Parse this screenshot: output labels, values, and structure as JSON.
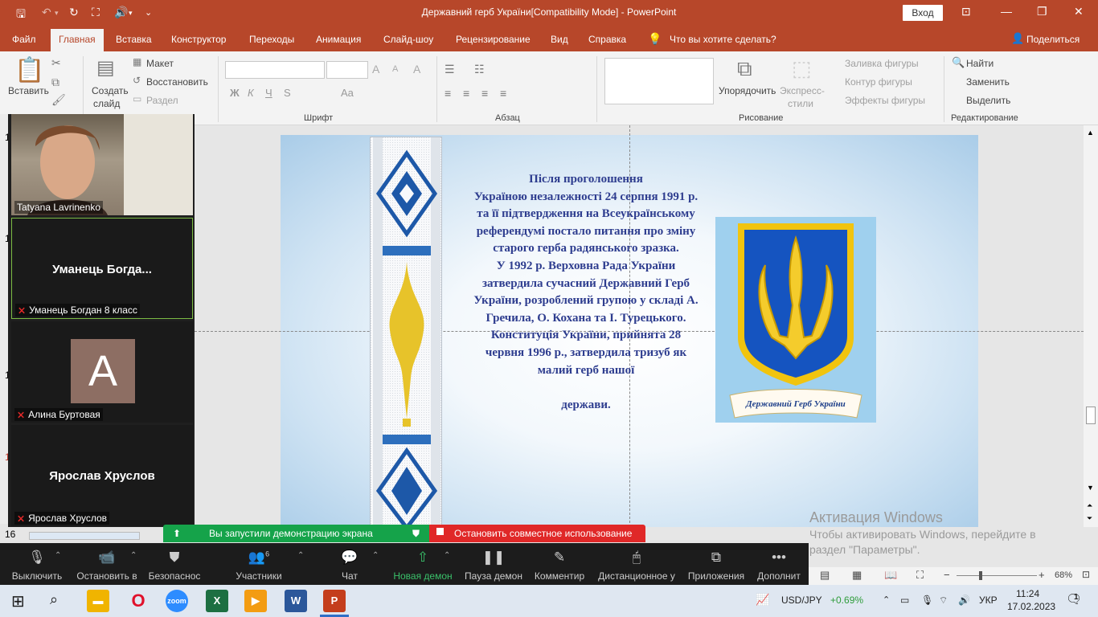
{
  "window": {
    "title": "Державний герб України[Compatibility Mode]  -  PowerPoint",
    "login": "Вход",
    "minimize": "—",
    "restore": "❐",
    "close": "✕"
  },
  "tabs": [
    "Файл",
    "Главная",
    "Вставка",
    "Конструктор",
    "Переходы",
    "Анимация",
    "Слайд-шоу",
    "Рецензирование",
    "Вид",
    "Справка"
  ],
  "tell_me": "Что вы хотите сделать?",
  "share": "Поделиться",
  "ribbon": {
    "paste": "Вставить",
    "new_slide_1": "Создать",
    "new_slide_2": "слайд",
    "layout": "Макет",
    "reset": "Восстановить",
    "section": "Раздел",
    "group_font": "Шрифт",
    "group_paragraph": "Абзац",
    "group_drawing": "Рисование",
    "group_editing": "Редактирование",
    "arrange": "Упорядочить",
    "quick_styles_1": "Экспресс-",
    "quick_styles_2": "стили",
    "shape_fill": "Заливка фигуры",
    "shape_outline": "Контур фигуры",
    "shape_effects": "Эффекты фигуры",
    "find": "Найти",
    "replace": "Заменить",
    "select": "Выделить",
    "bold": "Ж",
    "italic": "К",
    "underline": "Ч",
    "shadow": "S",
    "font_size_big": "A",
    "font_size_small": "A",
    "case": "Aa",
    "clear": "A"
  },
  "slide_text": "Після проголошення\nУкраїною незалежності 24 серпня 1991 р. та її підтвердження на Всеукраїнському референдумі постало питання про зміну старого герба радянського зразка.\n  У 1992 р. Верховна Рада України затвердила сучасний Державний Герб України, розроблений групою у складі А. Гречила, О. Кохана та І. Турецького.\nКонституція України, прийнята 28 червня 1996 р., затвердила тризуб як малий герб нашої\n\nдержави.",
  "coat_ribbon_text": "Державний Герб України",
  "participants": [
    {
      "name": "Tatyana Lavrinenko",
      "muted": false,
      "video": true
    },
    {
      "name": "Уманець Богдан 8 класс",
      "display": "Уманець  Богда...",
      "muted": true,
      "video": false
    },
    {
      "name": "Алина Буртовая",
      "avatar_letter": "A",
      "avatar_color": "#8d6e63",
      "muted": true,
      "video": false
    },
    {
      "name": "Ярослав Хруслов",
      "display": "Ярослав Хруслов",
      "muted": true,
      "video": false
    }
  ],
  "share_notice": {
    "started": "Вы запустили демонстрацию экрана",
    "stop": "Остановить совместное использование"
  },
  "zoom_toolbar": [
    {
      "label": "Выключить",
      "icon": "microphone-icon"
    },
    {
      "label": "Остановить в",
      "icon": "video-camera-icon"
    },
    {
      "label": "Безопаснос",
      "icon": "shield-icon"
    },
    {
      "label": "Участники",
      "icon": "people-icon",
      "count": "6"
    },
    {
      "label": "Чат",
      "icon": "chat-icon"
    },
    {
      "label": "Новая демон",
      "icon": "share-screen-icon"
    },
    {
      "label": "Пауза демон",
      "icon": "pause-icon"
    },
    {
      "label": "Комментир",
      "icon": "pen-icon"
    },
    {
      "label": "Дистанционное у",
      "icon": "mouse-icon"
    },
    {
      "label": "Приложения",
      "icon": "apps-icon"
    },
    {
      "label": "Дополнит",
      "icon": "more-icon"
    }
  ],
  "thumbnail_numbers": [
    "1",
    "1",
    "1",
    "1",
    "1",
    "16"
  ],
  "activation": {
    "title": "Активация Windows",
    "line1": "Чтобы активировать Windows, перейдите в",
    "line2": "раздел \"Параметры\"."
  },
  "status": {
    "zoom": "68%",
    "minus": "−",
    "plus": "+"
  },
  "taskbar": {
    "ticker": "USD/JPY",
    "change": "+0.69%",
    "lang": "УКР",
    "time": "11:24",
    "date": "17.02.2023",
    "notifications": "1"
  },
  "colors": {
    "ppt_accent": "#b7472a",
    "zoom_green": "#15a34a",
    "zoom_red": "#e02828",
    "slide_text": "#2e3d8f",
    "coat_shield": "#1554c0",
    "coat_gold": "#f1c40f"
  }
}
